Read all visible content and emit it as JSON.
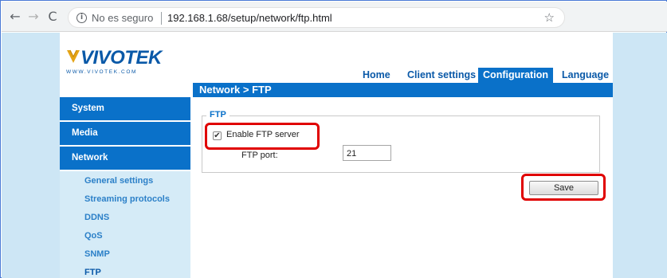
{
  "browser": {
    "security_label": "No es seguro",
    "url": "192.168.1.68/setup/network/ftp.html",
    "back_glyph": "←",
    "forward_glyph": "→",
    "reload_glyph": "C",
    "info_glyph": "i",
    "star_glyph": "☆"
  },
  "header": {
    "logo_text": "VIVOTEK",
    "logo_url": "WWW.VIVOTEK.COM",
    "nav": {
      "home": "Home",
      "client_settings": "Client settings",
      "configuration": "Configuration",
      "language": "Language"
    },
    "breadcrumb": "Network  > FTP"
  },
  "sidebar": {
    "main_items": [
      "System",
      "Media",
      "Network"
    ],
    "sub_items": [
      "General settings",
      "Streaming protocols",
      "DDNS",
      "QoS",
      "SNMP",
      "FTP"
    ]
  },
  "ftp": {
    "legend": "FTP",
    "enable_label": "Enable FTP server",
    "enable_checked": true,
    "check_glyph": "✔",
    "port_label": "FTP port:",
    "port_value": "21",
    "save_label": "Save"
  },
  "colors": {
    "brand_blue": "#0a71c9",
    "highlight_red": "#e00000",
    "page_bg": "#cde6f5"
  }
}
